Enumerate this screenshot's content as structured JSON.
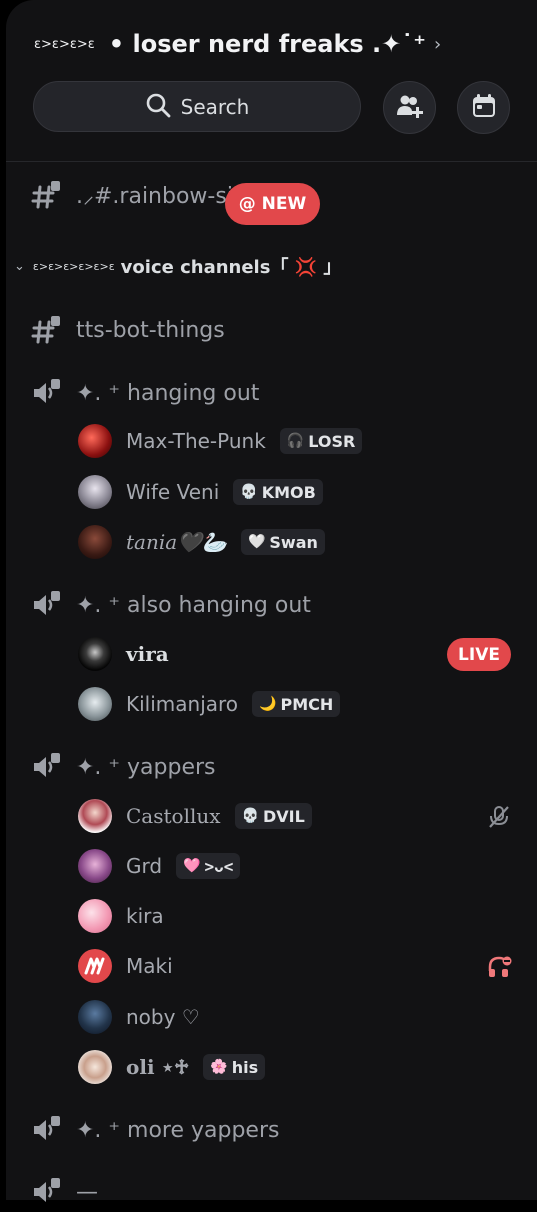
{
  "server": {
    "title_deco": "ɛ>ɛ>ɛ>ɛ",
    "name": "• loser nerd freaks .✦˙⁺",
    "chevron": "›"
  },
  "search": {
    "label": "Search",
    "icon": "search-icon"
  },
  "header_buttons": [
    {
      "icon": "add-member-icon"
    },
    {
      "icon": "calendar-icon"
    }
  ],
  "channels": {
    "rainbow": {
      "name": ".⸝#.rainbow-si",
      "badge": "@ NEW"
    },
    "voice_category": {
      "deco": "ɛ>ɛ>ɛ>ɛ>ɛ>ɛ",
      "name": "voice channels「 💢 」"
    },
    "tts": {
      "name": "tts-bot-things"
    },
    "hanging_out": {
      "name": "✦.  ⁺ hanging out",
      "members": [
        {
          "name": "Max-The-Punk",
          "tag": "LOSR",
          "tag_icon": "🎧"
        },
        {
          "name": "Wife Veni",
          "tag": "KMOB",
          "tag_icon": "💀"
        },
        {
          "name": "tania🖤🦢",
          "tag": "Swan",
          "tag_icon": "🤍"
        }
      ]
    },
    "also_hanging_out": {
      "name": "✦.  ⁺ also hanging out",
      "members": [
        {
          "name": "vira",
          "badge": "LIVE"
        },
        {
          "name": "Kilimanjaro",
          "tag": "PMCH",
          "tag_icon": "🌙"
        }
      ]
    },
    "yappers": {
      "name": "✦.  ⁺ yappers",
      "members": [
        {
          "name": "Castollux",
          "tag": "DVIL",
          "tag_icon": "💀",
          "state": "muted-icon"
        },
        {
          "name": "Grd",
          "tag": ">ᴗ<",
          "tag_icon": "🩷"
        },
        {
          "name": "kira"
        },
        {
          "name": "Maki",
          "state": "deafened-icon"
        },
        {
          "name": "noby ♡"
        },
        {
          "name": "oli ⋆♱",
          "tag": "his",
          "tag_icon": "🌸"
        }
      ]
    },
    "more_yappers": {
      "name": "✦.  ⁺ more yappers"
    },
    "last_channel": {
      "name": "—"
    }
  },
  "colors": {
    "background": "#121214",
    "accent_red": "#e2484b",
    "muted_text": "#9ea1a8"
  }
}
